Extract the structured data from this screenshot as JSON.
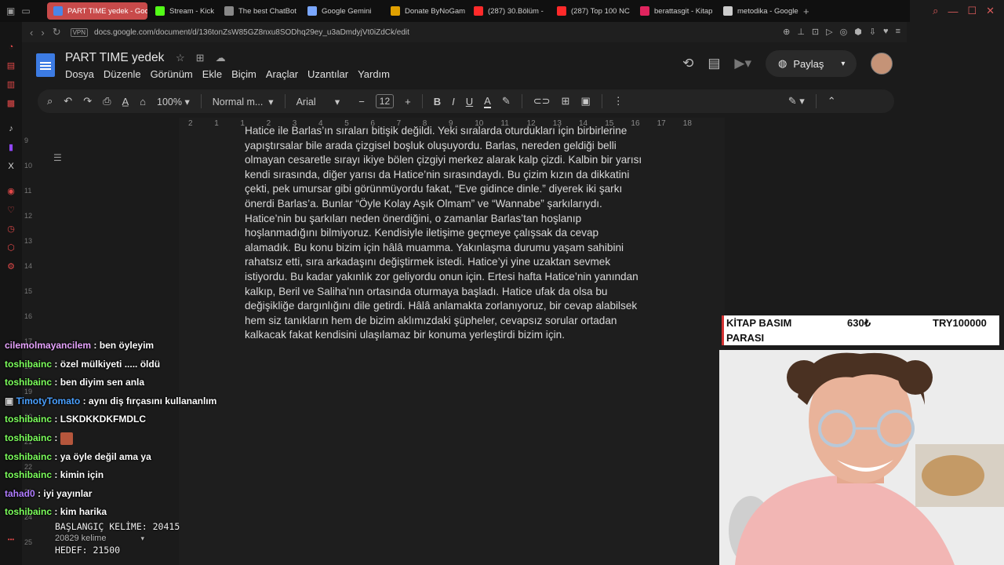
{
  "browser": {
    "tabs": [
      {
        "label": "PART TIME yedek - Goog",
        "active": true,
        "color": "#4a86e8"
      },
      {
        "label": "Stream - Kick",
        "active": false,
        "color": "#53fc18"
      },
      {
        "label": "The best ChatBot",
        "active": false,
        "color": "#888888"
      },
      {
        "label": "Google Gemini",
        "active": false,
        "color": "#7aa7ff"
      },
      {
        "label": "Donate ByNoGam",
        "active": false,
        "color": "#e0a000"
      },
      {
        "label": "(287) 30.Bölüm -",
        "active": false,
        "color": "#ff2a2a"
      },
      {
        "label": "(287) Top 100 NC",
        "active": false,
        "color": "#ff2a2a"
      },
      {
        "label": "berattasgit - Kitap",
        "active": false,
        "color": "#e0245e"
      },
      {
        "label": "metodika - Google",
        "active": false,
        "color": "#cccccc"
      }
    ],
    "new_tab": "+",
    "vpn_label": "VPN",
    "url": "docs.google.com/document/d/136tonZsW85GZ8nxu8SODhq29ey_u3aDmdyjVt0iZdCk/edit"
  },
  "docs": {
    "title": "PART TIME  yedek",
    "menu": [
      "Dosya",
      "Düzenle",
      "Görünüm",
      "Ekle",
      "Biçim",
      "Araçlar",
      "Uzantılar",
      "Yardım"
    ],
    "share_label": "Paylaş",
    "toolbar": {
      "zoom": "100%",
      "style": "Normal m...",
      "font": "Arial",
      "font_size": "12"
    },
    "ruler": [
      "2",
      "1",
      "1",
      "2",
      "3",
      "4",
      "5",
      "6",
      "7",
      "8",
      "9",
      "10",
      "11",
      "12",
      "13",
      "14",
      "15",
      "16",
      "17",
      "18"
    ],
    "vruler": [
      "9",
      "10",
      "11",
      "12",
      "13",
      "14",
      "15",
      "16",
      "17",
      "18",
      "19",
      "20",
      "21",
      "22",
      "23",
      "24",
      "25"
    ],
    "paragraph": "Hatice ile Barlas’ın sıraları bitişik değildi. Yeki sıralarda oturdukları için birbirlerine\nyapıştırsalar bile arada çizgisel boşluk oluşuyordu. Barlas, nereden geldiği belli\nolmayan cesaretle sırayı ikiye bölen çizgiyi merkez alarak kalp çizdi. Kalbin bir yarısı\nkendi sırasında, diğer yarısı da Hatice’nin sırasındaydı. Bu çizim kızın da dikkatini\nçekti, pek umursar gibi görünmüyordu fakat, “Eve gidince dinle.” diyerek iki şarkı\nönerdi Barlas’a. Bunlar “Öyle Kolay Aşık Olmam” ve “Wannabe” şarkılarıydı.\nHatice’nin bu şarkıları neden önerdiğini, o zamanlar Barlas’tan hoşlanıp\nhoşlanmadığını bilmiyoruz. Kendisiyle iletişime geçmeye çalışsak da cevap\nalamadık. Bu konu bizim için hâlâ muamma. Yakınlaşma durumu yaşam sahibini\nrahatsız etti, sıra arkadaşını değiştirmek istedi. Hatice’yi yine uzaktan sevmek\nistiyordu. Bu kadar yakınlık zor geliyordu onun için. Ertesi hafta Hatice’nin yanından\nkalkıp, Beril ve Saliha’nın ortasında oturmaya başladı. Hatice ufak da olsa bu\ndeğişikliğe dargınlığını dile getirdi. Hâlâ anlamakta zorlanıyoruz, bir cevap alabilsek\nhem siz tanıkların hem de bizim aklımızdaki şüpheler, cevapsız sorular ortadan\nkalkacak fakat kendisini ulaşılamaz bir konuma yerleştirdi bizim için."
  },
  "chat": [
    {
      "user": "cilemolmayancilem",
      "color": "#e8a4ff",
      "message": "ben öyleyim"
    },
    {
      "user": "toshibainc",
      "color": "#7cff5c",
      "message": "özel mülkiyeti ..... öldü"
    },
    {
      "user": "toshibainc",
      "color": "#7cff5c",
      "message": "ben diyim sen anla"
    },
    {
      "user": "TimotyTomato",
      "color": "#4aa0ff",
      "message": "aynı diş fırçasını kullananlım",
      "badge": true
    },
    {
      "user": "toshibainc",
      "color": "#7cff5c",
      "message": "LSKDKKDKFMDLC"
    },
    {
      "user": "toshibainc",
      "color": "#7cff5c",
      "message": "",
      "emote": true
    },
    {
      "user": "toshibainc",
      "color": "#7cff5c",
      "message": "ya öyle değil ama ya"
    },
    {
      "user": "toshibainc",
      "color": "#7cff5c",
      "message": "kimin için"
    },
    {
      "user": "tahad0",
      "color": "#b07cff",
      "message": "iyi yayınlar"
    },
    {
      "user": "toshibainc",
      "color": "#7cff5c",
      "message": "kim harika"
    }
  ],
  "counter": {
    "start_label": "BAŞLANGIÇ KELİME: 20415",
    "word_count": "20829 kelime",
    "goal_label": "HEDEF: 21500"
  },
  "goal": {
    "title": "KİTAP BASIM",
    "title2": "PARASI",
    "current": "630₺",
    "target": "TRY100000"
  }
}
